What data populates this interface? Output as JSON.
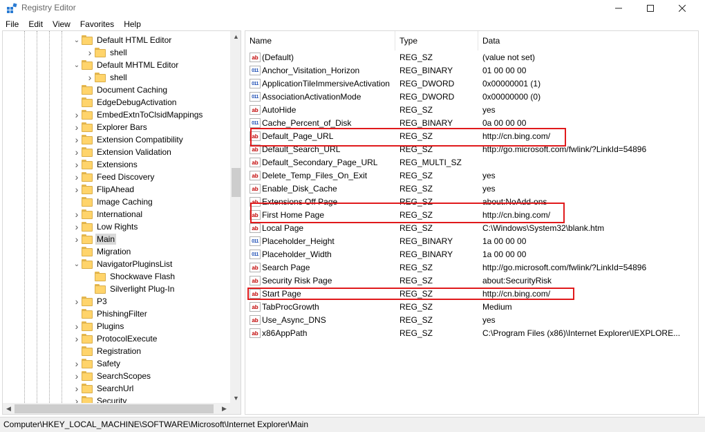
{
  "window": {
    "title": "Registry Editor",
    "icon": "registry-editor-icon"
  },
  "menu": [
    "File",
    "Edit",
    "View",
    "Favorites",
    "Help"
  ],
  "tree": {
    "nodes": [
      {
        "label": "Default HTML Editor",
        "expander": "expanded"
      },
      {
        "label": "shell",
        "expander": "collapsed"
      },
      {
        "label": "Default MHTML Editor",
        "expander": "expanded"
      },
      {
        "label": "shell",
        "expander": "collapsed"
      },
      {
        "label": "Document Caching",
        "expander": "none"
      },
      {
        "label": "EdgeDebugActivation",
        "expander": "none"
      },
      {
        "label": "EmbedExtnToClsidMappings",
        "expander": "collapsed"
      },
      {
        "label": "Explorer Bars",
        "expander": "collapsed"
      },
      {
        "label": "Extension Compatibility",
        "expander": "collapsed"
      },
      {
        "label": "Extension Validation",
        "expander": "collapsed"
      },
      {
        "label": "Extensions",
        "expander": "collapsed"
      },
      {
        "label": "Feed Discovery",
        "expander": "collapsed"
      },
      {
        "label": "FlipAhead",
        "expander": "collapsed"
      },
      {
        "label": "Image Caching",
        "expander": "none"
      },
      {
        "label": "International",
        "expander": "collapsed"
      },
      {
        "label": "Low Rights",
        "expander": "collapsed"
      },
      {
        "label": "Main",
        "expander": "collapsed",
        "selected": true
      },
      {
        "label": "Migration",
        "expander": "none"
      },
      {
        "label": "NavigatorPluginsList",
        "expander": "expanded"
      },
      {
        "label": "Shockwave Flash",
        "expander": "none"
      },
      {
        "label": "Silverlight Plug-In",
        "expander": "none"
      },
      {
        "label": "P3",
        "expander": "collapsed"
      },
      {
        "label": "PhishingFilter",
        "expander": "none"
      },
      {
        "label": "Plugins",
        "expander": "collapsed"
      },
      {
        "label": "ProtocolExecute",
        "expander": "collapsed"
      },
      {
        "label": "Registration",
        "expander": "none"
      },
      {
        "label": "Safety",
        "expander": "collapsed"
      },
      {
        "label": "SearchScopes",
        "expander": "collapsed"
      },
      {
        "label": "SearchUrl",
        "expander": "collapsed"
      },
      {
        "label": "Security",
        "expander": "collapsed"
      }
    ]
  },
  "list": {
    "headers": {
      "name": "Name",
      "type": "Type",
      "data": "Data"
    },
    "rows": [
      {
        "icon": "string-value-icon",
        "name": "(Default)",
        "type": "REG_SZ",
        "data": "(value not set)"
      },
      {
        "icon": "binary-value-icon",
        "name": "Anchor_Visitation_Horizon",
        "type": "REG_BINARY",
        "data": "01 00 00 00"
      },
      {
        "icon": "binary-value-icon",
        "name": "ApplicationTileImmersiveActivation",
        "type": "REG_DWORD",
        "data": "0x00000001 (1)"
      },
      {
        "icon": "binary-value-icon",
        "name": "AssociationActivationMode",
        "type": "REG_DWORD",
        "data": "0x00000000 (0)"
      },
      {
        "icon": "string-value-icon",
        "name": "AutoHide",
        "type": "REG_SZ",
        "data": "yes"
      },
      {
        "icon": "binary-value-icon",
        "name": "Cache_Percent_of_Disk",
        "type": "REG_BINARY",
        "data": "0a 00 00 00"
      },
      {
        "icon": "string-value-icon",
        "name": "Default_Page_URL",
        "type": "REG_SZ",
        "data": "http://cn.bing.com/",
        "highlighted": true
      },
      {
        "icon": "string-value-icon",
        "name": "Default_Search_URL",
        "type": "REG_SZ",
        "data": "http://go.microsoft.com/fwlink/?LinkId=54896"
      },
      {
        "icon": "string-value-icon",
        "name": "Default_Secondary_Page_URL",
        "type": "REG_MULTI_SZ",
        "data": ""
      },
      {
        "icon": "string-value-icon",
        "name": "Delete_Temp_Files_On_Exit",
        "type": "REG_SZ",
        "data": "yes"
      },
      {
        "icon": "string-value-icon",
        "name": "Enable_Disk_Cache",
        "type": "REG_SZ",
        "data": "yes"
      },
      {
        "icon": "string-value-icon",
        "name": "Extensions Off Page",
        "type": "REG_SZ",
        "data": "about:NoAdd-ons"
      },
      {
        "icon": "string-value-icon",
        "name": "First Home Page",
        "type": "REG_SZ",
        "data": "http://cn.bing.com/",
        "highlighted": true
      },
      {
        "icon": "string-value-icon",
        "name": "Local Page",
        "type": "REG_SZ",
        "data": "C:\\Windows\\System32\\blank.htm"
      },
      {
        "icon": "binary-value-icon",
        "name": "Placeholder_Height",
        "type": "REG_BINARY",
        "data": "1a 00 00 00"
      },
      {
        "icon": "binary-value-icon",
        "name": "Placeholder_Width",
        "type": "REG_BINARY",
        "data": "1a 00 00 00"
      },
      {
        "icon": "string-value-icon",
        "name": "Search Page",
        "type": "REG_SZ",
        "data": "http://go.microsoft.com/fwlink/?LinkId=54896"
      },
      {
        "icon": "string-value-icon",
        "name": "Security Risk Page",
        "type": "REG_SZ",
        "data": "about:SecurityRisk"
      },
      {
        "icon": "string-value-icon",
        "name": "Start Page",
        "type": "REG_SZ",
        "data": "http://cn.bing.com/",
        "highlighted": true
      },
      {
        "icon": "string-value-icon",
        "name": "TabProcGrowth",
        "type": "REG_SZ",
        "data": "Medium"
      },
      {
        "icon": "string-value-icon",
        "name": "Use_Async_DNS",
        "type": "REG_SZ",
        "data": "yes"
      },
      {
        "icon": "string-value-icon",
        "name": "x86AppPath",
        "type": "REG_SZ",
        "data": "C:\\Program Files (x86)\\Internet Explorer\\IEXPLORE..."
      }
    ]
  },
  "status": {
    "path": "Computer\\HKEY_LOCAL_MACHINE\\SOFTWARE\\Microsoft\\Internet Explorer\\Main"
  },
  "colors": {
    "highlight_box": "#e0191b",
    "folder": "#ffd46b",
    "selection": "#d9d9d9"
  }
}
